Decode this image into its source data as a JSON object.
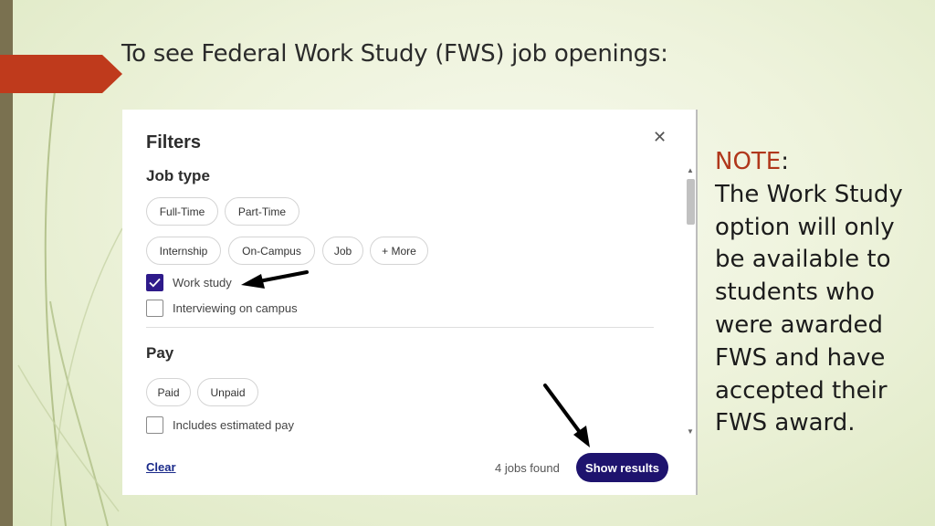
{
  "slide": {
    "title": "To see Federal Work Study (FWS) job openings:",
    "note_label": "NOTE",
    "note_colon": ":",
    "note_lines": [
      "The Work Study",
      "option will only",
      "be available to",
      "students who",
      "were awarded",
      "FWS and have",
      "accepted their",
      "FWS award."
    ],
    "colors": {
      "accent_red": "#bf3a1c",
      "left_bar": "#7a7150",
      "note_label": "#b0371b"
    }
  },
  "filters": {
    "title": "Filters",
    "close_icon": "close-icon",
    "job_type": {
      "title": "Job type",
      "chips_row1": [
        "Full-Time",
        "Part-Time"
      ],
      "chips_row2": [
        "Internship",
        "On-Campus",
        "Job",
        "+ More"
      ],
      "checkboxes": [
        {
          "label": "Work study",
          "checked": true
        },
        {
          "label": "Interviewing on campus",
          "checked": false
        }
      ]
    },
    "pay": {
      "title": "Pay",
      "chips": [
        "Paid",
        "Unpaid"
      ],
      "checkboxes": [
        {
          "label": "Includes estimated pay",
          "checked": false
        }
      ]
    },
    "footer": {
      "clear_label": "Clear",
      "jobs_found": "4 jobs found",
      "show_results_label": "Show results",
      "button_color": "#1e136e"
    }
  }
}
